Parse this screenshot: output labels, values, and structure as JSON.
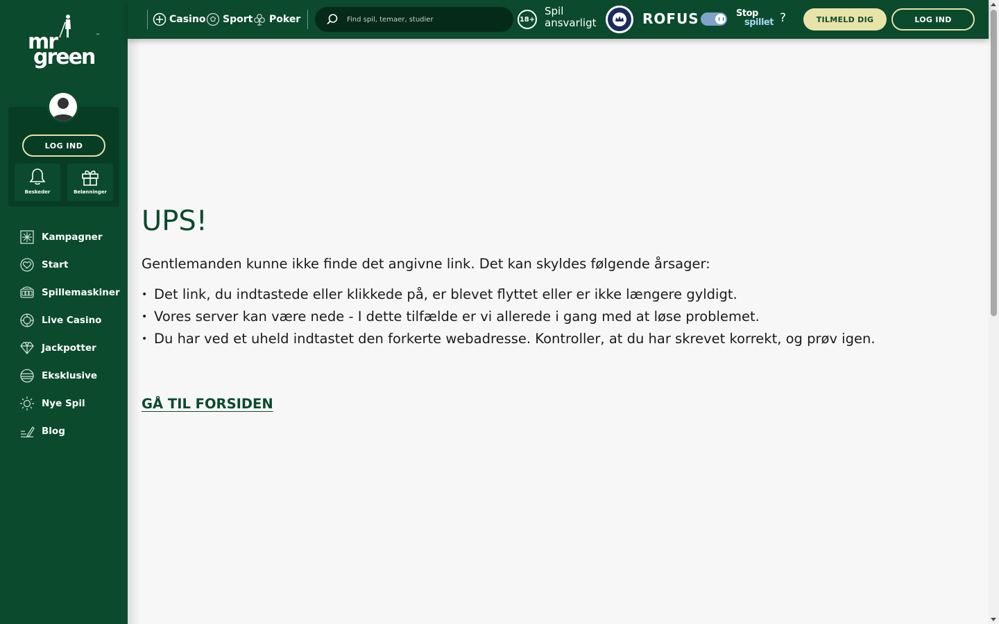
{
  "brand": {
    "logo_line1": "mr",
    "logo_line2": "green",
    "trademark": "™"
  },
  "sidebar": {
    "login_label": "LOG IND",
    "tiles": [
      {
        "label": "Beskeder",
        "icon": "bell-icon"
      },
      {
        "label": "Belønninger",
        "icon": "gift-icon"
      }
    ],
    "nav": [
      {
        "label": "Kampagner",
        "icon": "snowflake-grid-icon"
      },
      {
        "label": "Start",
        "icon": "heart-icon"
      },
      {
        "label": "Spillemaskiner",
        "icon": "slot-machine-icon"
      },
      {
        "label": "Live Casino",
        "icon": "chip-icon"
      },
      {
        "label": "Jackpotter",
        "icon": "diamond-icon"
      },
      {
        "label": "Eksklusive",
        "icon": "globe-stripes-icon"
      },
      {
        "label": "Nye Spil",
        "icon": "sun-icon"
      },
      {
        "label": "Blog",
        "icon": "pen-lines-icon"
      }
    ]
  },
  "topbar": {
    "links": [
      {
        "label": "Casino",
        "icon": "casino-chip-icon"
      },
      {
        "label": "Sport",
        "icon": "soccer-ball-icon"
      },
      {
        "label": "Poker",
        "icon": "club-icon"
      }
    ],
    "search_placeholder": "Find spil, temaer, studier",
    "age_label": "18+",
    "responsible_line1": "Spil",
    "responsible_line2": "ansvarligt",
    "rofus_label": "ROFUS",
    "stop_line1": "Stop",
    "stop_line2": "spillet",
    "help_label": "?",
    "signup_label": "TILMELD DIG",
    "login_label": "LOG IND"
  },
  "main": {
    "title": "UPS!",
    "lead": "Gentlemanden kunne ikke finde det angivne link. Det kan skyldes følgende årsager:",
    "reasons": [
      "Det link, du indtastede eller klikkede på, er blevet flyttet eller er ikke længere gyldigt.",
      "Vores server kan være nede - I dette tilfælde er vi allerede i gang med at løse problemet.",
      "Du har ved et uheld indtastet den forkerte webadresse. Kontroller, at du har skrevet korrekt, og prøv igen."
    ],
    "home_link": "GÅ TIL FORSIDEN"
  },
  "colors": {
    "brand_green": "#0b4a2d",
    "accent_cream": "#e8e3a8",
    "page_bg": "#f7f7f7"
  }
}
